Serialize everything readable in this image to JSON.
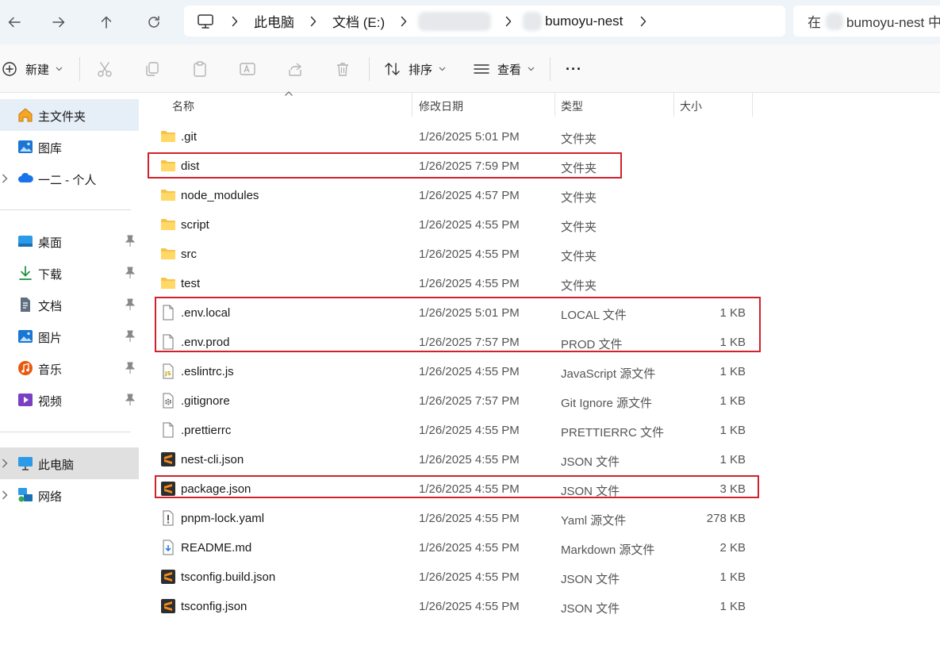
{
  "address": {
    "pc_label": "此电脑",
    "drive_label": "文档 (E:)",
    "folder_label": "bumoyu-nest"
  },
  "search": {
    "prefix": "在",
    "text": "bumoyu-nest 中"
  },
  "toolbar": {
    "new_label": "新建",
    "sort_label": "排序",
    "view_label": "查看",
    "more_label": "···"
  },
  "sidebar": {
    "home": "主文件夹",
    "gallery": "图库",
    "onedrive": "一二 - 个人",
    "desktop": "桌面",
    "downloads": "下载",
    "documents": "文档",
    "pictures": "图片",
    "music": "音乐",
    "videos": "视频",
    "this_pc": "此电脑",
    "network": "网络"
  },
  "columns": {
    "name": "名称",
    "date": "修改日期",
    "type": "类型",
    "size": "大小"
  },
  "files": [
    {
      "name": ".git",
      "date": "1/26/2025 5:01 PM",
      "type": "文件夹",
      "size": ""
    },
    {
      "name": "dist",
      "date": "1/26/2025 7:59 PM",
      "type": "文件夹",
      "size": ""
    },
    {
      "name": "node_modules",
      "date": "1/26/2025 4:57 PM",
      "type": "文件夹",
      "size": ""
    },
    {
      "name": "script",
      "date": "1/26/2025 4:55 PM",
      "type": "文件夹",
      "size": ""
    },
    {
      "name": "src",
      "date": "1/26/2025 4:55 PM",
      "type": "文件夹",
      "size": ""
    },
    {
      "name": "test",
      "date": "1/26/2025 4:55 PM",
      "type": "文件夹",
      "size": ""
    },
    {
      "name": ".env.local",
      "date": "1/26/2025 5:01 PM",
      "type": "LOCAL 文件",
      "size": "1 KB"
    },
    {
      "name": ".env.prod",
      "date": "1/26/2025 7:57 PM",
      "type": "PROD 文件",
      "size": "1 KB"
    },
    {
      "name": ".eslintrc.js",
      "date": "1/26/2025 4:55 PM",
      "type": "JavaScript 源文件",
      "size": "1 KB"
    },
    {
      "name": ".gitignore",
      "date": "1/26/2025 7:57 PM",
      "type": "Git Ignore 源文件",
      "size": "1 KB"
    },
    {
      "name": ".prettierrc",
      "date": "1/26/2025 4:55 PM",
      "type": "PRETTIERRC 文件",
      "size": "1 KB"
    },
    {
      "name": "nest-cli.json",
      "date": "1/26/2025 4:55 PM",
      "type": "JSON 文件",
      "size": "1 KB"
    },
    {
      "name": "package.json",
      "date": "1/26/2025 4:55 PM",
      "type": "JSON 文件",
      "size": "3 KB"
    },
    {
      "name": "pnpm-lock.yaml",
      "date": "1/26/2025 4:55 PM",
      "type": "Yaml 源文件",
      "size": "278 KB"
    },
    {
      "name": "README.md",
      "date": "1/26/2025 4:55 PM",
      "type": "Markdown 源文件",
      "size": "2 KB"
    },
    {
      "name": "tsconfig.build.json",
      "date": "1/26/2025 4:55 PM",
      "type": "JSON 文件",
      "size": "1 KB"
    },
    {
      "name": "tsconfig.json",
      "date": "1/26/2025 4:55 PM",
      "type": "JSON 文件",
      "size": "1 KB"
    }
  ],
  "colors": {
    "highlight": "#d2212b",
    "folder": "#f6c34a",
    "accent": "#0067c0",
    "sublime": "#f28b20"
  }
}
